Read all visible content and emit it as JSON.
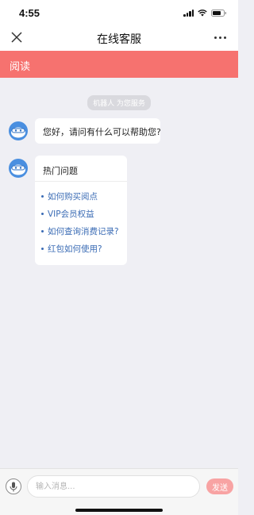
{
  "status_bar": {
    "time": "4:55"
  },
  "nav": {
    "title": "在线客服",
    "close_icon": "close-icon",
    "more_icon": "more-icon"
  },
  "banner": {
    "label": "阅读",
    "color": "#f6726f"
  },
  "chat": {
    "system_tip": "机器人 为您服务",
    "greeting": "您好，请问有什么可以帮助您?",
    "faq": {
      "title": "热门问题",
      "items": [
        "如何购买阅点",
        "VIP会员权益",
        "如何查询消费记录?",
        "红包如何使用?"
      ]
    }
  },
  "input_bar": {
    "placeholder": "输入消息...",
    "send_label": "发送",
    "send_color": "#f8a3a3",
    "mic_icon": "microphone-icon"
  }
}
